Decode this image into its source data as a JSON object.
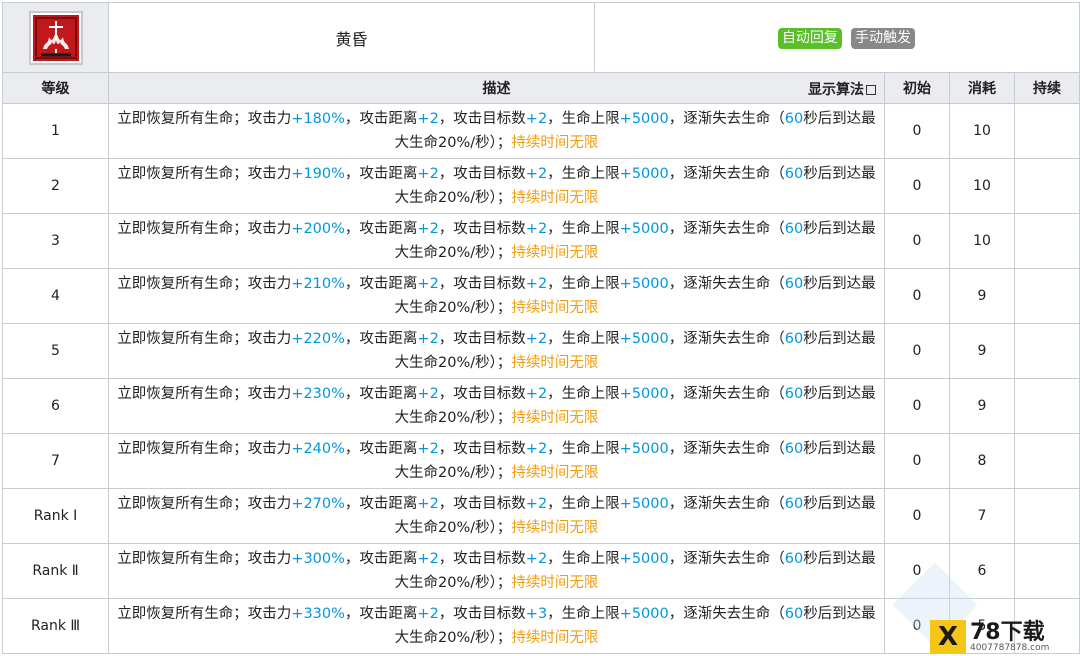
{
  "skill": {
    "name": "黄昏",
    "icon": "skill-flame-emblem-icon",
    "tags": [
      "自动回复",
      "手动触发"
    ]
  },
  "columns": {
    "level": "等级",
    "desc": "描述",
    "algo": "显示算法",
    "initial": "初始",
    "cost": "消耗",
    "duration": "持续"
  },
  "desc_text": {
    "p1": "立即恢复所有生命；攻击力",
    "p2": "，攻击距离",
    "p3": "，攻击目标数",
    "p4": "，生命上限",
    "p5": "，逐渐失去生命（",
    "p6": "秒后到达最大生命20%/秒）；",
    "duration_text": "持续时间无限"
  },
  "rows": [
    {
      "level": "1",
      "atk": "+180%",
      "range": "+2",
      "targets": "+2",
      "hp": "+5000",
      "sec": "60",
      "initial": "0",
      "cost": "10",
      "duration": ""
    },
    {
      "level": "2",
      "atk": "+190%",
      "range": "+2",
      "targets": "+2",
      "hp": "+5000",
      "sec": "60",
      "initial": "0",
      "cost": "10",
      "duration": ""
    },
    {
      "level": "3",
      "atk": "+200%",
      "range": "+2",
      "targets": "+2",
      "hp": "+5000",
      "sec": "60",
      "initial": "0",
      "cost": "10",
      "duration": ""
    },
    {
      "level": "4",
      "atk": "+210%",
      "range": "+2",
      "targets": "+2",
      "hp": "+5000",
      "sec": "60",
      "initial": "0",
      "cost": "9",
      "duration": ""
    },
    {
      "level": "5",
      "atk": "+220%",
      "range": "+2",
      "targets": "+2",
      "hp": "+5000",
      "sec": "60",
      "initial": "0",
      "cost": "9",
      "duration": ""
    },
    {
      "level": "6",
      "atk": "+230%",
      "range": "+2",
      "targets": "+2",
      "hp": "+5000",
      "sec": "60",
      "initial": "0",
      "cost": "9",
      "duration": ""
    },
    {
      "level": "7",
      "atk": "+240%",
      "range": "+2",
      "targets": "+2",
      "hp": "+5000",
      "sec": "60",
      "initial": "0",
      "cost": "8",
      "duration": ""
    },
    {
      "level": "Rank Ⅰ",
      "atk": "+270%",
      "range": "+2",
      "targets": "+2",
      "hp": "+5000",
      "sec": "60",
      "initial": "0",
      "cost": "7",
      "duration": ""
    },
    {
      "level": "Rank Ⅱ",
      "atk": "+300%",
      "range": "+2",
      "targets": "+2",
      "hp": "+5000",
      "sec": "60",
      "initial": "0",
      "cost": "6",
      "duration": ""
    },
    {
      "level": "Rank Ⅲ",
      "atk": "+330%",
      "range": "+2",
      "targets": "+3",
      "hp": "+5000",
      "sec": "60",
      "initial": "0",
      "cost": "5",
      "duration": ""
    }
  ],
  "watermark": {
    "logo": "X",
    "brand": "78下载",
    "url": "4007787878.com"
  }
}
